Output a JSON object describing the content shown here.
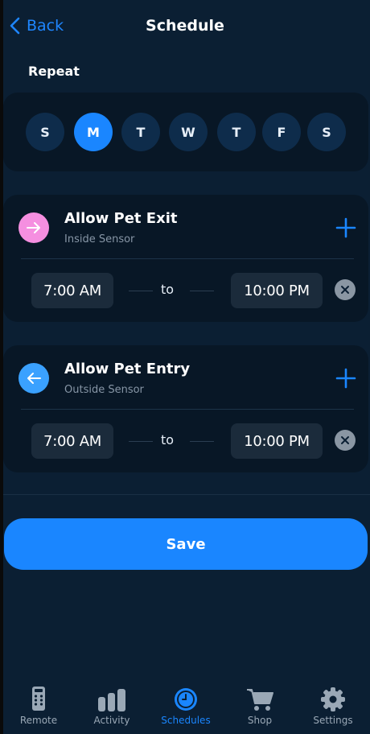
{
  "header": {
    "back_label": "Back",
    "title": "Schedule"
  },
  "repeat": {
    "label": "Repeat",
    "days": [
      {
        "label": "S",
        "selected": false
      },
      {
        "label": "M",
        "selected": true
      },
      {
        "label": "T",
        "selected": false
      },
      {
        "label": "W",
        "selected": false
      },
      {
        "label": "T",
        "selected": false
      },
      {
        "label": "F",
        "selected": false
      },
      {
        "label": "S",
        "selected": false
      }
    ]
  },
  "rules": [
    {
      "title": "Allow Pet Exit",
      "subtitle": "Inside Sensor",
      "icon": "arrow-right-icon",
      "icon_color": "#f58fe0",
      "start": "7:00 AM",
      "to_label": "to",
      "end": "10:00 PM"
    },
    {
      "title": "Allow Pet Entry",
      "subtitle": "Outside Sensor",
      "icon": "arrow-left-icon",
      "icon_color": "#3aa1ff",
      "start": "7:00 AM",
      "to_label": "to",
      "end": "10:00 PM"
    }
  ],
  "save_label": "Save",
  "tabs": [
    {
      "label": "Remote",
      "icon": "remote-icon",
      "active": false
    },
    {
      "label": "Activity",
      "icon": "bar-chart-icon",
      "active": false
    },
    {
      "label": "Schedules",
      "icon": "clock-icon",
      "active": true
    },
    {
      "label": "Shop",
      "icon": "cart-icon",
      "active": false
    },
    {
      "label": "Settings",
      "icon": "gear-icon",
      "active": false
    }
  ],
  "colors": {
    "accent": "#1a86ff",
    "background": "#0b1f33",
    "card": "#081726"
  }
}
